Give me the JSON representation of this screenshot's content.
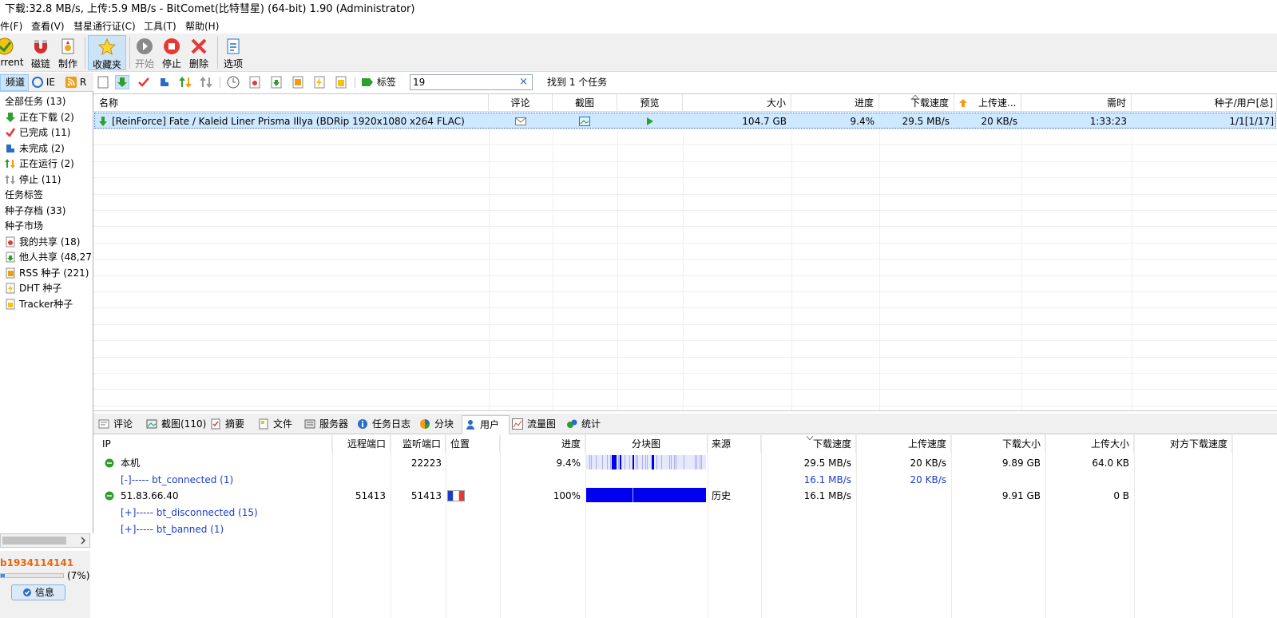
{
  "window": {
    "title": "下载:32.8 MB/s, 上传:5.9 MB/s - BitComet(比特彗星) (64-bit) 1.90 (Administrator)"
  },
  "menu": [
    "件(F)",
    "查看(V)",
    "彗星通行证(C)",
    "工具(T)",
    "帮助(H)"
  ],
  "toolbar": {
    "torrent": "rrent",
    "magnet": "磁链",
    "make": "制作",
    "favorites": "收藏夹",
    "start": "开始",
    "stop": "停止",
    "delete": "删除",
    "options": "选项"
  },
  "left_tabs": {
    "channel": "频道",
    "ie": "IE",
    "rss": "R"
  },
  "tree": [
    {
      "label": "全部任务 (13)",
      "icon": "none"
    },
    {
      "label": "正在下载 (2)",
      "icon": "down-arrow-icon"
    },
    {
      "label": "已完成 (11)",
      "icon": "check-icon"
    },
    {
      "label": "未完成 (2)",
      "icon": "blue-square-icon"
    },
    {
      "label": "正在运行 (2)",
      "icon": "updown-arrow-icon"
    },
    {
      "label": "停止 (11)",
      "icon": "stopped-icon"
    },
    {
      "label": "任务标签",
      "icon": "none"
    },
    {
      "label": "种子存档 (33)",
      "icon": "none"
    },
    {
      "label": "种子市场",
      "icon": "none"
    },
    {
      "label": "我的共享 (18)",
      "icon": "share-icon"
    },
    {
      "label": "他人共享 (48,27",
      "icon": "others-share-icon"
    },
    {
      "label": "RSS 种子 (221)",
      "icon": "rss-icon"
    },
    {
      "label": "DHT 种子",
      "icon": "dht-icon"
    },
    {
      "label": "Tracker种子",
      "icon": "tracker-icon"
    }
  ],
  "user": {
    "id": "b1934114141",
    "percent": "(7%)",
    "progress": 0.07,
    "info_label": "信息"
  },
  "filter": {
    "tag_label": "标签",
    "search_value": "19",
    "clear": "×",
    "result": "找到 1 个任务"
  },
  "tasks": {
    "columns": [
      "名称",
      "评论",
      "截图",
      "预览",
      "大小",
      "进度",
      "下载速度",
      "上传速...",
      "需时",
      "种子/用户[总]"
    ],
    "rows": [
      {
        "name": "[ReinForce] Fate / Kaleid Liner Prisma Illya (BDRip 1920x1080 x264 FLAC)",
        "size": "104.7 GB",
        "progress": "9.4%",
        "down_speed": "29.5 MB/s",
        "up_speed": "20 KB/s",
        "eta": "1:33:23",
        "seeds": "1/1[1/17]"
      }
    ]
  },
  "bottom_tabs": [
    "评论",
    "截图(110)",
    "摘要",
    "文件",
    "服务器",
    "任务日志",
    "分块",
    "用户",
    "流量图",
    "统计"
  ],
  "peers": {
    "columns": [
      "IP",
      "远程端口",
      "监听端口",
      "位置",
      "进度",
      "分块图",
      "来源",
      "下载速度",
      "上传速度",
      "下载大小",
      "上传大小",
      "对方下载速度"
    ],
    "rows": [
      {
        "ip": "本机",
        "remote_port": "",
        "listen_port": "22223",
        "progress": "9.4%",
        "source": "",
        "down": "29.5 MB/s",
        "up": "20 KB/s",
        "down_size": "9.89 GB",
        "up_size": "64.0 KB"
      },
      {
        "ip": "[-]----- bt_connected (1)",
        "down": "16.1 MB/s",
        "up": "20 KB/s"
      },
      {
        "ip": "51.83.66.40",
        "remote_port": "51413",
        "listen_port": "51413",
        "progress": "100%",
        "source": "历史",
        "down": "16.1 MB/s",
        "up": "",
        "down_size": "9.91 GB",
        "up_size": "0 B"
      },
      {
        "ip": "[+]----- bt_disconnected (15)"
      },
      {
        "ip": "[+]----- bt_banned (1)"
      }
    ]
  },
  "colors": {
    "selection": "#cde8ff",
    "piece_blue": "#0000ee",
    "link_blue": "#1a3ccc",
    "user_id": "#e8660c"
  }
}
